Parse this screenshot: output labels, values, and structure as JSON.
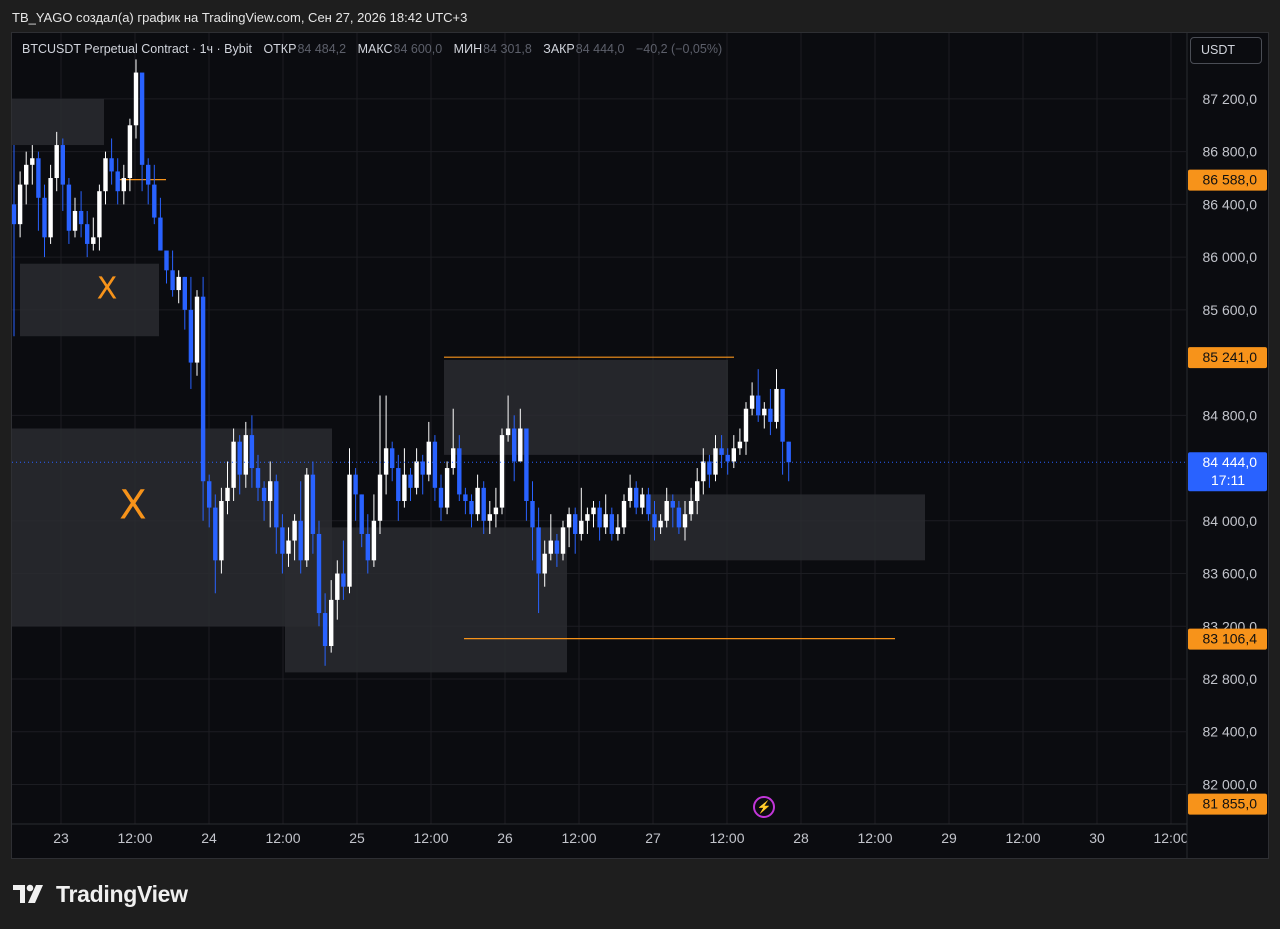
{
  "caption": "TB_YAGO создал(а) график на TradingView.com, Сен 27, 2026 18:42 UTC+3",
  "legend": {
    "symbol": "BTCUSDT Perpetual Contract · 1ч · Bybit",
    "open_label": "ОТКР",
    "open": "84 484,2",
    "high_label": "МАКС",
    "high": "84 600,0",
    "low_label": "МИН",
    "low": "84 301,8",
    "close_label": "ЗАКР",
    "close": "84 444,0",
    "change": "−40,2 (−0,05%)"
  },
  "currency": "USDT",
  "brand": "TradingView",
  "colors": {
    "background": "#0b0c10",
    "up": "#ffffff",
    "down": "#2962ff",
    "zone": "#2a2b30",
    "level": "#f7931a",
    "grid": "#1c1d22",
    "price_axis_text": "#c3c5cc"
  },
  "chart_data": {
    "type": "candlestick",
    "symbol": "BTCUSDT",
    "timeframe": "1h",
    "ylim": [
      81700,
      87700
    ],
    "x_tick_labels": [
      "23",
      "12:00",
      "24",
      "12:00",
      "25",
      "12:00",
      "26",
      "12:00",
      "27",
      "12:00",
      "28",
      "12:00",
      "29",
      "12:00",
      "30",
      "12:00"
    ],
    "y_tick_labels": [
      "87 200,0",
      "86 800,0",
      "86 400,0",
      "86 000,0",
      "85 600,0",
      "84 800,0",
      "84 000,0",
      "83 600,0",
      "83 200,0",
      "82 800,0",
      "82 400,0",
      "82 000,0"
    ],
    "y_ticks": [
      87200,
      86800,
      86400,
      86000,
      85600,
      84800,
      84000,
      83600,
      83200,
      82800,
      82400,
      82000
    ],
    "price_labels": [
      {
        "text": "86 588,0",
        "value": 86588,
        "color": "#f7931a"
      },
      {
        "text": "85 241,0",
        "value": 85241,
        "color": "#f7931a"
      },
      {
        "text": "84 444,0",
        "value": 84444,
        "color": "#2962ff",
        "sub": "17:11"
      },
      {
        "text": "83 106,4",
        "value": 83106.4,
        "color": "#f7931a"
      },
      {
        "text": "81 855,0",
        "value": 81855,
        "color": "#f7931a"
      }
    ],
    "current_price": 84444,
    "candles": [
      [
        86400,
        86250,
        86850,
        85400
      ],
      [
        86250,
        86550,
        86650,
        86150
      ],
      [
        86550,
        86700,
        86800,
        86400
      ],
      [
        86700,
        86750,
        86850,
        86550
      ],
      [
        86750,
        86450,
        86800,
        86200
      ],
      [
        86450,
        86150,
        86550,
        86000
      ],
      [
        86150,
        86600,
        86700,
        86100
      ],
      [
        86600,
        86850,
        86950,
        86500
      ],
      [
        86850,
        86550,
        86900,
        86350
      ],
      [
        86550,
        86200,
        86600,
        86100
      ],
      [
        86200,
        86350,
        86450,
        86150
      ],
      [
        86350,
        86250,
        86500,
        86150
      ],
      [
        86250,
        86100,
        86350,
        86000
      ],
      [
        86100,
        86150,
        86300,
        86050
      ],
      [
        86150,
        86500,
        86550,
        86050
      ],
      [
        86500,
        86750,
        86800,
        86400
      ],
      [
        86750,
        86650,
        86900,
        86550
      ],
      [
        86650,
        86500,
        86750,
        86400
      ],
      [
        86500,
        86600,
        86700,
        86400
      ],
      [
        86600,
        87000,
        87050,
        86500
      ],
      [
        87000,
        87400,
        87500,
        86900
      ],
      [
        87400,
        86700,
        87300,
        86500
      ],
      [
        86700,
        86550,
        86750,
        86400
      ],
      [
        86550,
        86300,
        86700,
        86250
      ],
      [
        86300,
        86050,
        86450,
        86050
      ],
      [
        86050,
        85900,
        86050,
        85800
      ],
      [
        85900,
        85750,
        86050,
        85700
      ],
      [
        85750,
        85850,
        85900,
        85650
      ],
      [
        85850,
        85600,
        85850,
        85450
      ],
      [
        85600,
        85200,
        85850,
        85000
      ],
      [
        85200,
        85700,
        85750,
        85100
      ],
      [
        85700,
        84300,
        85850,
        84000
      ],
      [
        84300,
        84100,
        84350,
        83950
      ],
      [
        84100,
        83700,
        84200,
        83450
      ],
      [
        83700,
        84150,
        84250,
        83600
      ],
      [
        84150,
        84250,
        84450,
        84050
      ],
      [
        84250,
        84600,
        84700,
        84150
      ],
      [
        84600,
        84350,
        84650,
        84200
      ],
      [
        84350,
        84650,
        84750,
        84250
      ],
      [
        84650,
        84400,
        84800,
        84250
      ],
      [
        84400,
        84250,
        84500,
        84150
      ],
      [
        84250,
        84150,
        84300,
        84000
      ],
      [
        84150,
        84300,
        84450,
        83950
      ],
      [
        84300,
        83950,
        84350,
        83750
      ],
      [
        83950,
        83750,
        84050,
        83600
      ],
      [
        83750,
        83850,
        83950,
        83650
      ],
      [
        83850,
        84000,
        84050,
        83700
      ],
      [
        84000,
        83700,
        84300,
        83600
      ],
      [
        83700,
        84350,
        84400,
        83650
      ],
      [
        84350,
        83900,
        84450,
        83750
      ],
      [
        83900,
        83300,
        84000,
        83200
      ],
      [
        83300,
        83050,
        83450,
        82900
      ],
      [
        83050,
        83400,
        83550,
        83000
      ],
      [
        83400,
        83600,
        83700,
        83250
      ],
      [
        83600,
        83500,
        83850,
        83400
      ],
      [
        83500,
        84350,
        84550,
        83450
      ],
      [
        84350,
        84200,
        84400,
        84000
      ],
      [
        84200,
        83900,
        84200,
        83800
      ],
      [
        83900,
        83700,
        84050,
        83600
      ],
      [
        83700,
        84000,
        84200,
        83650
      ],
      [
        84000,
        84350,
        84950,
        83900
      ],
      [
        84350,
        84550,
        84950,
        84200
      ],
      [
        84550,
        84400,
        84600,
        84300
      ],
      [
        84400,
        84150,
        84500,
        84000
      ],
      [
        84150,
        84350,
        84550,
        84100
      ],
      [
        84350,
        84250,
        84400,
        84150
      ],
      [
        84250,
        84450,
        84550,
        84200
      ],
      [
        84450,
        84350,
        84500,
        84200
      ],
      [
        84350,
        84600,
        84750,
        84300
      ],
      [
        84600,
        84250,
        84650,
        84150
      ],
      [
        84250,
        84100,
        84350,
        84000
      ],
      [
        84100,
        84400,
        84450,
        84050
      ],
      [
        84400,
        84550,
        84850,
        84350
      ],
      [
        84550,
        84200,
        84650,
        84150
      ],
      [
        84200,
        84150,
        84250,
        84050
      ],
      [
        84150,
        84050,
        84200,
        83950
      ],
      [
        84050,
        84250,
        84350,
        84000
      ],
      [
        84250,
        84000,
        84300,
        83900
      ],
      [
        84000,
        84050,
        84150,
        83900
      ],
      [
        84050,
        84100,
        84250,
        83950
      ],
      [
        84100,
        84650,
        84700,
        84050
      ],
      [
        84650,
        84700,
        84950,
        84600
      ],
      [
        84700,
        84450,
        84800,
        84300
      ],
      [
        84450,
        84700,
        84850,
        84600
      ],
      [
        84700,
        84150,
        84700,
        84000
      ],
      [
        84150,
        83950,
        84300,
        83700
      ],
      [
        83950,
        83600,
        84100,
        83300
      ],
      [
        83600,
        83750,
        83850,
        83500
      ],
      [
        83750,
        83850,
        84050,
        83700
      ],
      [
        83850,
        83750,
        83900,
        83650
      ],
      [
        83750,
        83950,
        84000,
        83700
      ],
      [
        83950,
        84050,
        84100,
        83800
      ],
      [
        84050,
        83900,
        84100,
        83750
      ],
      [
        83900,
        84000,
        84250,
        83850
      ],
      [
        84000,
        84050,
        84100,
        83900
      ],
      [
        84050,
        84100,
        84150,
        83950
      ],
      [
        84100,
        83950,
        84150,
        83850
      ],
      [
        83950,
        84050,
        84200,
        83900
      ],
      [
        84050,
        83900,
        84100,
        83850
      ],
      [
        83900,
        83950,
        84050,
        83850
      ],
      [
        83950,
        84150,
        84200,
        83900
      ],
      [
        84150,
        84250,
        84350,
        84100
      ],
      [
        84250,
        84100,
        84300,
        84050
      ],
      [
        84100,
        84200,
        84250,
        84050
      ],
      [
        84200,
        84050,
        84250,
        84000
      ],
      [
        84050,
        83950,
        84150,
        83850
      ],
      [
        83950,
        84000,
        84050,
        83900
      ],
      [
        84000,
        84150,
        84250,
        83950
      ],
      [
        84150,
        84100,
        84200,
        83950
      ],
      [
        84100,
        83950,
        84150,
        83900
      ],
      [
        83950,
        84050,
        84150,
        83850
      ],
      [
        84050,
        84150,
        84250,
        84000
      ],
      [
        84150,
        84300,
        84400,
        84050
      ],
      [
        84300,
        84450,
        84550,
        84200
      ],
      [
        84450,
        84350,
        84500,
        84250
      ],
      [
        84350,
        84550,
        84650,
        84300
      ],
      [
        84550,
        84500,
        84650,
        84400
      ],
      [
        84500,
        84450,
        84550,
        84350
      ],
      [
        84450,
        84550,
        84650,
        84400
      ],
      [
        84550,
        84600,
        84700,
        84500
      ],
      [
        84600,
        84850,
        84900,
        84500
      ],
      [
        84850,
        84950,
        85050,
        84800
      ],
      [
        84950,
        84800,
        85150,
        84750
      ],
      [
        84800,
        84850,
        84900,
        84700
      ],
      [
        84850,
        84750,
        85000,
        84650
      ],
      [
        84750,
        85000,
        85150,
        84700
      ],
      [
        85000,
        84600,
        85000,
        84350
      ],
      [
        84600,
        84444,
        84600,
        84300
      ]
    ],
    "zones": [
      {
        "x0": 0,
        "x1": 92,
        "top": 87200,
        "bottom": 86850
      },
      {
        "x0": 8,
        "x1": 147,
        "top": 85950,
        "bottom": 85400
      },
      {
        "x0": 0,
        "x1": 320,
        "top": 84700,
        "bottom": 83200
      },
      {
        "x0": 273,
        "x1": 555,
        "top": 83950,
        "bottom": 82850
      },
      {
        "x0": 432,
        "x1": 716,
        "top": 85220,
        "bottom": 84500
      },
      {
        "x0": 638,
        "x1": 913,
        "top": 84200,
        "bottom": 83700
      }
    ],
    "levels": [
      {
        "value": 86588,
        "x0": 105,
        "x1": 154
      },
      {
        "value": 85241,
        "x0": 432,
        "x1": 722
      },
      {
        "value": 83106.4,
        "x0": 452,
        "x1": 883
      }
    ],
    "annotations": [
      {
        "text": "X",
        "x": 95,
        "value": 85750
      },
      {
        "text": "X",
        "x": 121,
        "value": 84100
      }
    ]
  }
}
